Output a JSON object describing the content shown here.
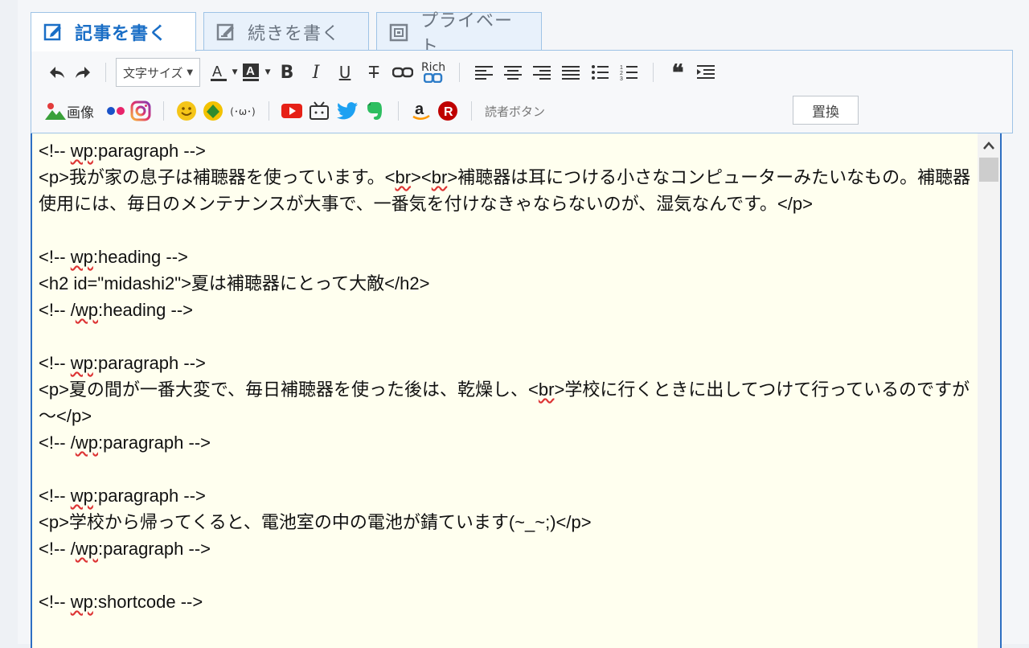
{
  "tabs": [
    {
      "label": "記事を書く",
      "icon": "edit-article-icon",
      "active": true
    },
    {
      "label": "続きを書く",
      "icon": "edit-continue-icon",
      "active": false
    },
    {
      "label": "プライベート",
      "icon": "private-icon",
      "active": false
    }
  ],
  "toolbar": {
    "font_size_label": "文字サイズ",
    "rich_label": "Rich",
    "image_label": "画像",
    "reader_button_label": "読者ボタン",
    "replace_label": "置換",
    "kaomoji_label": "(･ω･)"
  },
  "editor": {
    "lines": [
      "<!-- wp:paragraph -->",
      "<p>我が家の息子は補聴器を使っています。<br><br>補聴器は耳につける小さなコンピューターみたいなもの。補聴器使用には、毎日のメンテナンスが大事で、一番気を付けなきゃならないのが、湿気なんです。</p>",
      "",
      "<!-- wp:heading -->",
      "<h2 id=\"midashi2\">夏は補聴器にとって大敵</h2>",
      "<!-- /wp:heading -->",
      "",
      "<!-- wp:paragraph -->",
      "<p>夏の間が一番大変で、毎日補聴器を使った後は、乾燥し、<br>学校に行くときに出してつけて行っているのですが～</p>",
      "<!-- /wp:paragraph -->",
      "",
      "<!-- wp:paragraph -->",
      "<p>学校から帰ってくると、電池室の中の電池が錆ています(~_~;)</p>",
      "<!-- /wp:paragraph -->",
      "",
      "<!-- wp:shortcode -->"
    ]
  },
  "colors": {
    "accent": "#1a6ec6",
    "editor_bg": "#ffffef",
    "border": "#9ec3e6"
  }
}
